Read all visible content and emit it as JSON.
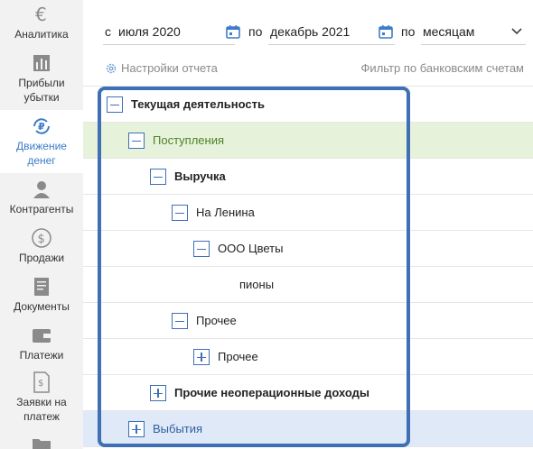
{
  "sidebar": {
    "items": [
      {
        "label": "Аналитика",
        "icon": "euro-icon"
      },
      {
        "label": "Прибыли\nубытки",
        "icon": "bar-chart-icon"
      },
      {
        "label": "Движение\nденег",
        "icon": "money-flow-icon",
        "active": true
      },
      {
        "label": "Контрагенты",
        "icon": "person-icon"
      },
      {
        "label": "Продажи",
        "icon": "dollar-coin-icon"
      },
      {
        "label": "Документы",
        "icon": "document-icon"
      },
      {
        "label": "Платежи",
        "icon": "wallet-icon"
      },
      {
        "label": "Заявки на\nплатеж",
        "icon": "invoice-icon"
      },
      {
        "label": "",
        "icon": "folder-icon"
      }
    ]
  },
  "filters": {
    "from_prefix": "с",
    "from_value": "июля 2020",
    "to_prefix": "по",
    "to_value": "декабрь 2021",
    "group_prefix": "по",
    "group_value": "месяцам"
  },
  "settings": {
    "report_settings": "Настройки отчета",
    "bank_filter": "Фильтр по банковским счетам"
  },
  "tree": {
    "rows": [
      {
        "label": "Текущая деятельность",
        "level": 0,
        "toggle": "minus",
        "style": "bold"
      },
      {
        "label": "Поступления",
        "level": 1,
        "toggle": "minus",
        "style": "green"
      },
      {
        "label": "Выручка",
        "level": 2,
        "toggle": "minus",
        "style": "bold"
      },
      {
        "label": "На Ленина",
        "level": 3,
        "toggle": "minus",
        "style": "normal"
      },
      {
        "label": "ООО Цветы",
        "level": 4,
        "toggle": "minus",
        "style": "normal"
      },
      {
        "label": "пионы",
        "level": 5,
        "toggle": "none",
        "style": "normal"
      },
      {
        "label": "Прочее",
        "level": 3,
        "toggle": "minus",
        "style": "normal"
      },
      {
        "label": "Прочее",
        "level": 4,
        "toggle": "plus",
        "style": "normal"
      },
      {
        "label": "Прочие неоперационные доходы",
        "level": 2,
        "toggle": "plus",
        "style": "bold"
      },
      {
        "label": "Выбытия",
        "level": 1,
        "toggle": "plus",
        "style": "blue"
      }
    ]
  },
  "colors": {
    "accent": "#3f6fb5",
    "active_nav": "#3d7cc9",
    "income_bg": "#e6f3da",
    "expense_bg": "#dfe9f8"
  }
}
